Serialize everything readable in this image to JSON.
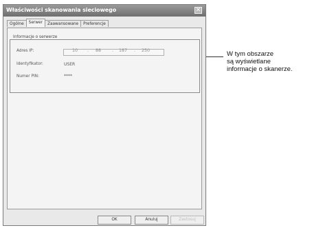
{
  "dialog": {
    "title": "Właściwości skanowania sieciowego",
    "close_symbol": "✕"
  },
  "tabs": [
    {
      "label": "Ogólne",
      "active": false
    },
    {
      "label": "Serwer",
      "active": true
    },
    {
      "label": "Zaawansowane",
      "active": false
    },
    {
      "label": "Preferencje",
      "active": false
    }
  ],
  "server_info": {
    "group_title": "Informacje o serwerze",
    "ip_label": "Adres IP:",
    "ip_octets": [
      "10",
      "88",
      "187",
      "250"
    ],
    "id_label": "Identyfikator:",
    "id_value": "USER",
    "pin_label": "Numer PIN:",
    "pin_value": "****"
  },
  "buttons": {
    "ok": "OK",
    "cancel": "Anuluj",
    "apply": "Zastosuj"
  },
  "callout": {
    "line1": "W tym obszarze",
    "line2": "są wyświetlane",
    "line3": "informacje o skanerze."
  }
}
